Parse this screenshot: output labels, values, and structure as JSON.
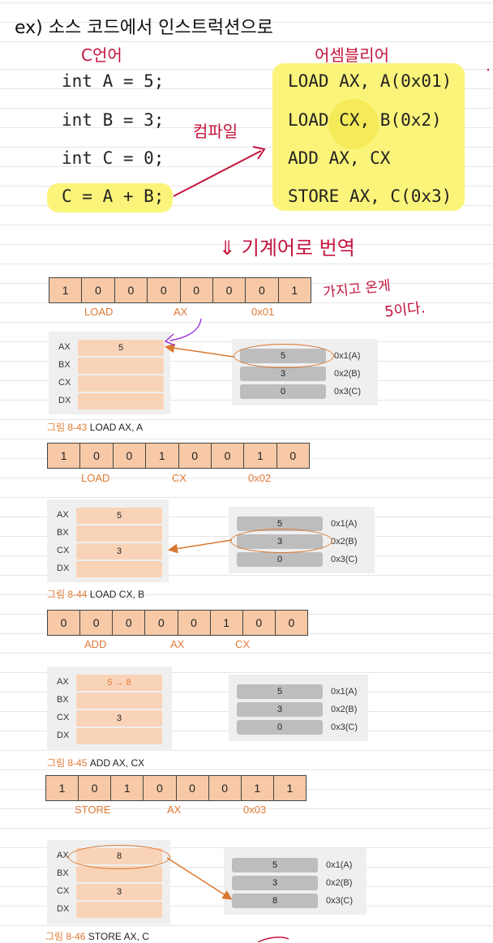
{
  "header": "ex) 소스 코드에서 인스트럭션으로",
  "labels": {
    "c_lang": "C언어",
    "asm": "어셈블리어",
    "compile": "컴파일",
    "translate": "⇓ 기계어로 번역",
    "note_line1": "가지고 온게",
    "note_line2": "5이다."
  },
  "c_code": [
    "int A = 5;",
    "int B = 3;",
    "int C = 0;",
    "C = A + B;"
  ],
  "asm_code": [
    "LOAD AX, A(0x01)",
    "LOAD CX, B(0x2)",
    "ADD AX, CX",
    "STORE AX, C(0x3)"
  ],
  "figures": [
    {
      "bits": [
        "1",
        "0",
        "0",
        "0",
        "0",
        "0",
        "0",
        "1"
      ],
      "fields": [
        "LOAD",
        "AX",
        "0x01"
      ],
      "registers": [
        {
          "name": "AX",
          "value": "5"
        },
        {
          "name": "BX",
          "value": ""
        },
        {
          "name": "CX",
          "value": ""
        },
        {
          "name": "DX",
          "value": ""
        }
      ],
      "memory": [
        {
          "value": "5",
          "addr": "0x1(A)"
        },
        {
          "value": "3",
          "addr": "0x2(B)"
        },
        {
          "value": "0",
          "addr": "0x3(C)"
        }
      ],
      "caption_num": "그림 8-43",
      "caption_text": "LOAD AX, A"
    },
    {
      "bits": [
        "1",
        "0",
        "0",
        "1",
        "0",
        "0",
        "1",
        "0"
      ],
      "fields": [
        "LOAD",
        "CX",
        "0x02"
      ],
      "registers": [
        {
          "name": "AX",
          "value": "5"
        },
        {
          "name": "BX",
          "value": ""
        },
        {
          "name": "CX",
          "value": "3"
        },
        {
          "name": "DX",
          "value": ""
        }
      ],
      "memory": [
        {
          "value": "5",
          "addr": "0x1(A)"
        },
        {
          "value": "3",
          "addr": "0x2(B)"
        },
        {
          "value": "0",
          "addr": "0x3(C)"
        }
      ],
      "caption_num": "그림 8-44",
      "caption_text": "LOAD CX, B"
    },
    {
      "bits": [
        "0",
        "0",
        "0",
        "0",
        "0",
        "1",
        "0",
        "0"
      ],
      "fields": [
        "ADD",
        "AX",
        "CX"
      ],
      "registers": [
        {
          "name": "AX",
          "value": "5 → 8"
        },
        {
          "name": "BX",
          "value": ""
        },
        {
          "name": "CX",
          "value": "3"
        },
        {
          "name": "DX",
          "value": ""
        }
      ],
      "memory": [
        {
          "value": "5",
          "addr": "0x1(A)"
        },
        {
          "value": "3",
          "addr": "0x2(B)"
        },
        {
          "value": "0",
          "addr": "0x3(C)"
        }
      ],
      "caption_num": "그림 8-45",
      "caption_text": "ADD AX, CX"
    },
    {
      "bits": [
        "1",
        "0",
        "1",
        "0",
        "0",
        "0",
        "1",
        "1"
      ],
      "fields": [
        "STORE",
        "AX",
        "0x03"
      ],
      "registers": [
        {
          "name": "AX",
          "value": "8"
        },
        {
          "name": "BX",
          "value": ""
        },
        {
          "name": "CX",
          "value": "3"
        },
        {
          "name": "DX",
          "value": ""
        }
      ],
      "memory": [
        {
          "value": "5",
          "addr": "0x1(A)"
        },
        {
          "value": "3",
          "addr": "0x2(B)"
        },
        {
          "value": "8",
          "addr": "0x3(C)"
        }
      ],
      "caption_num": "그림 8-46",
      "caption_text": "STORE AX, C"
    }
  ],
  "colors": {
    "highlight": "#fbf47a",
    "handwriting": "#c5133b",
    "orange": "#e07a35",
    "bit_fill": "#f7c9a7",
    "reg_fill": "#f9d3b7",
    "mem_fill": "#bdbdbd",
    "annotation_purple": "#9b2fd6"
  }
}
